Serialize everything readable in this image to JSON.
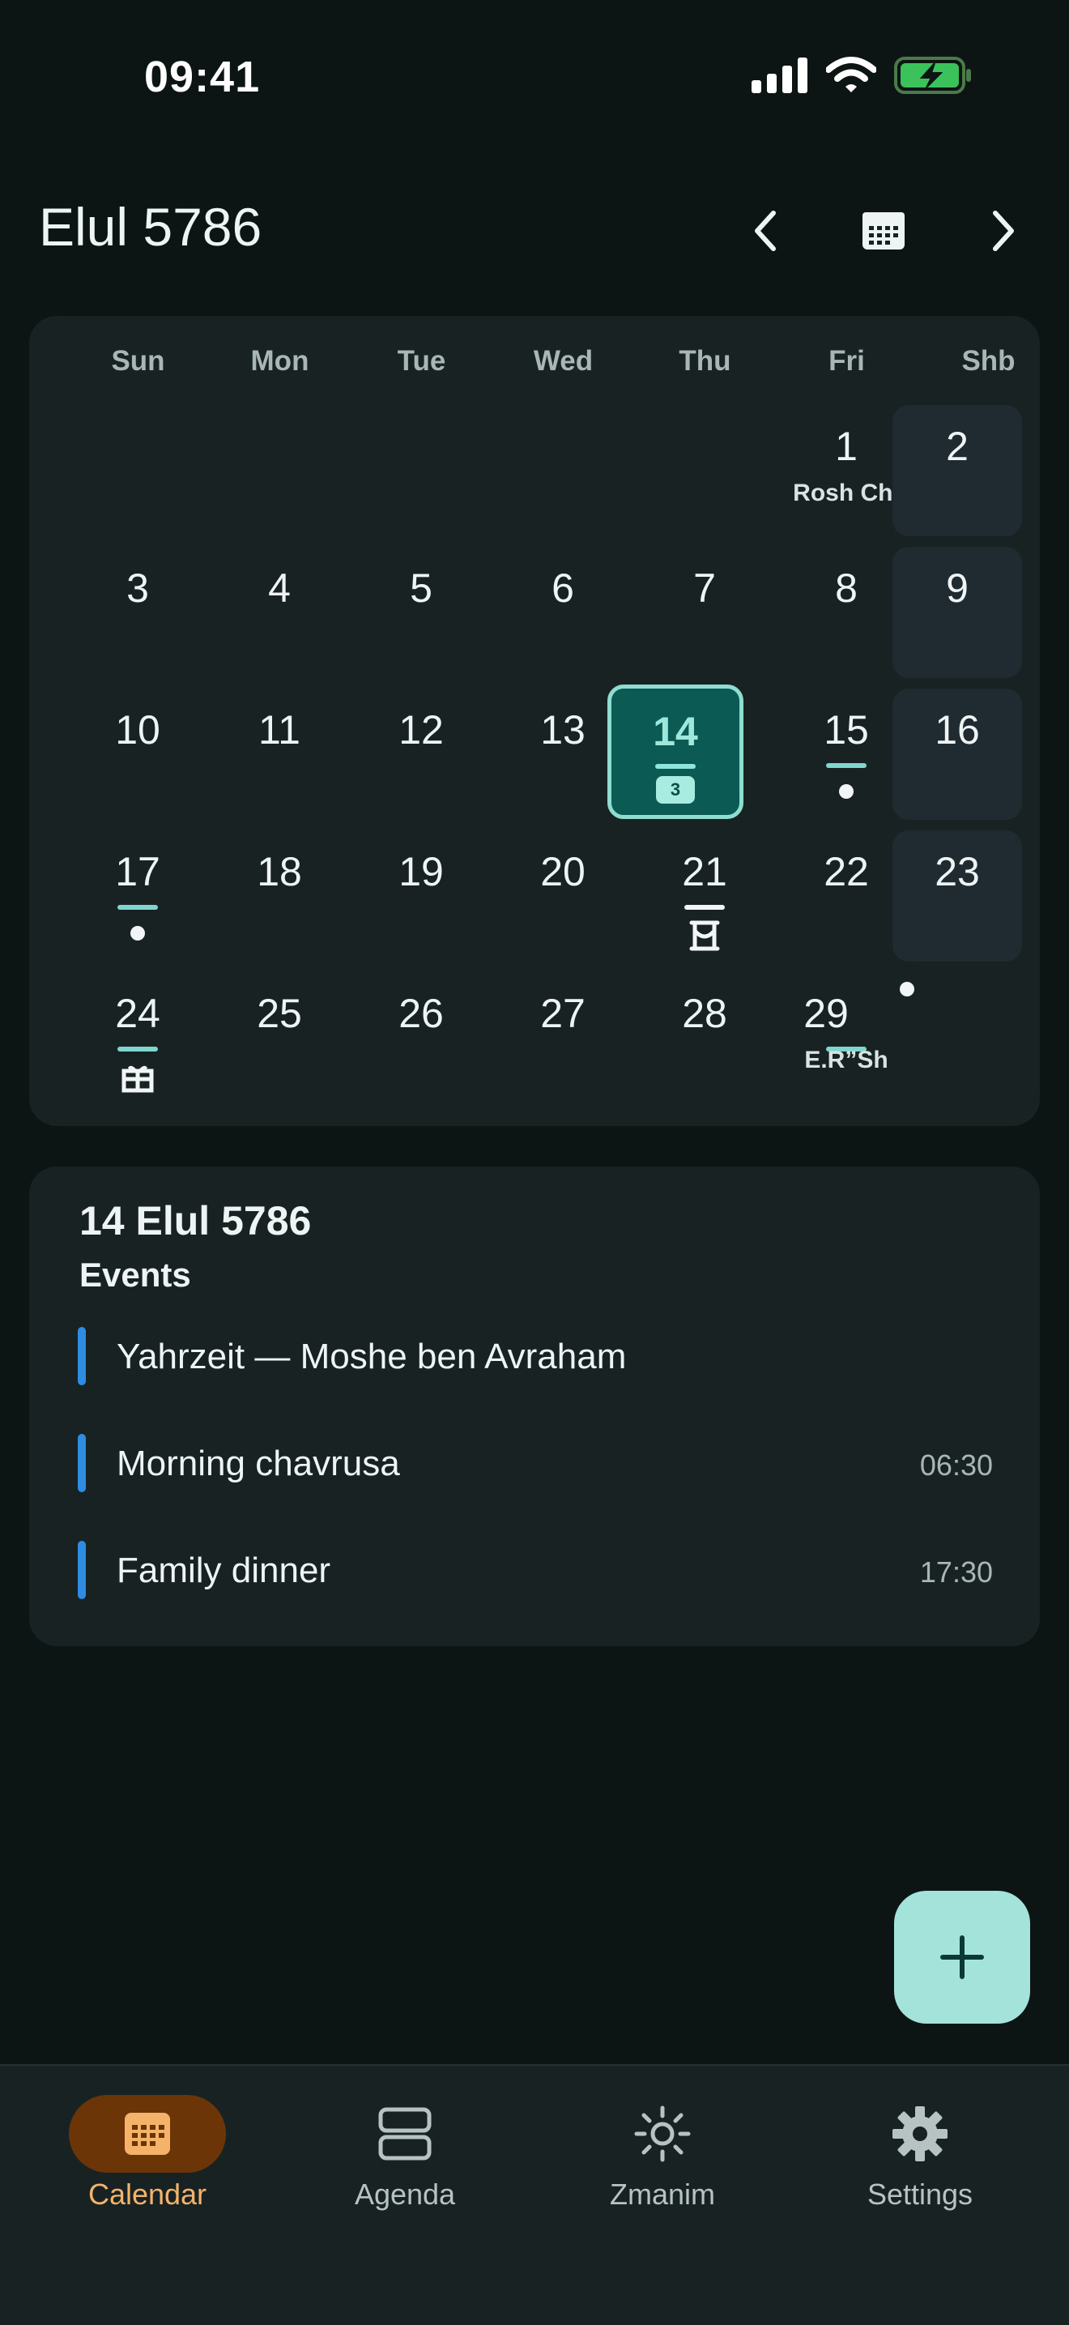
{
  "status_bar": {
    "time": "09:41"
  },
  "header": {
    "month_title": "Elul 5786"
  },
  "calendar": {
    "weekdays": [
      "Sun",
      "Mon",
      "Tue",
      "Wed",
      "Thu",
      "Fri",
      "Shb"
    ],
    "days": {
      "d1": "1",
      "d1_label": "Rosh Ch.",
      "d2": "2",
      "d3": "3",
      "d4": "4",
      "d5": "5",
      "d6": "6",
      "d7": "7",
      "d8": "8",
      "d9": "9",
      "d10": "10",
      "d11": "11",
      "d12": "12",
      "d13": "13",
      "d14": "14",
      "d14_badge": "3",
      "d15": "15",
      "d16": "16",
      "d17": "17",
      "d18": "18",
      "d19": "19",
      "d20": "20",
      "d21": "21",
      "d22": "22",
      "d23": "23",
      "d24": "24",
      "d25": "25",
      "d26": "26",
      "d27": "27",
      "d28": "28",
      "d29": "29",
      "d29_label": "E.R”Sh"
    },
    "selected_day": "14"
  },
  "events_panel": {
    "date": "14 Elul 5786",
    "heading": "Events",
    "events": [
      {
        "title": "Yahrzeit — Moshe ben Avraham",
        "time": ""
      },
      {
        "title": "Morning chavrusa",
        "time": "06:30"
      },
      {
        "title": "Family dinner",
        "time": "17:30"
      }
    ]
  },
  "bottom_nav": {
    "items": [
      {
        "label": "Calendar",
        "icon": "calendar-icon",
        "active": true
      },
      {
        "label": "Agenda",
        "icon": "agenda-icon",
        "active": false
      },
      {
        "label": "Zmanim",
        "icon": "sun-icon",
        "active": false
      },
      {
        "label": "Settings",
        "icon": "gear-icon",
        "active": false
      }
    ]
  },
  "colors": {
    "background": "#0c1414",
    "card": "#182222",
    "accent_teal": "#a3e3d9",
    "today_fill": "#0b5a54",
    "event_bar": "#2e8de2",
    "active_nav": "#f5b36a",
    "active_nav_pill": "#6b3508"
  }
}
